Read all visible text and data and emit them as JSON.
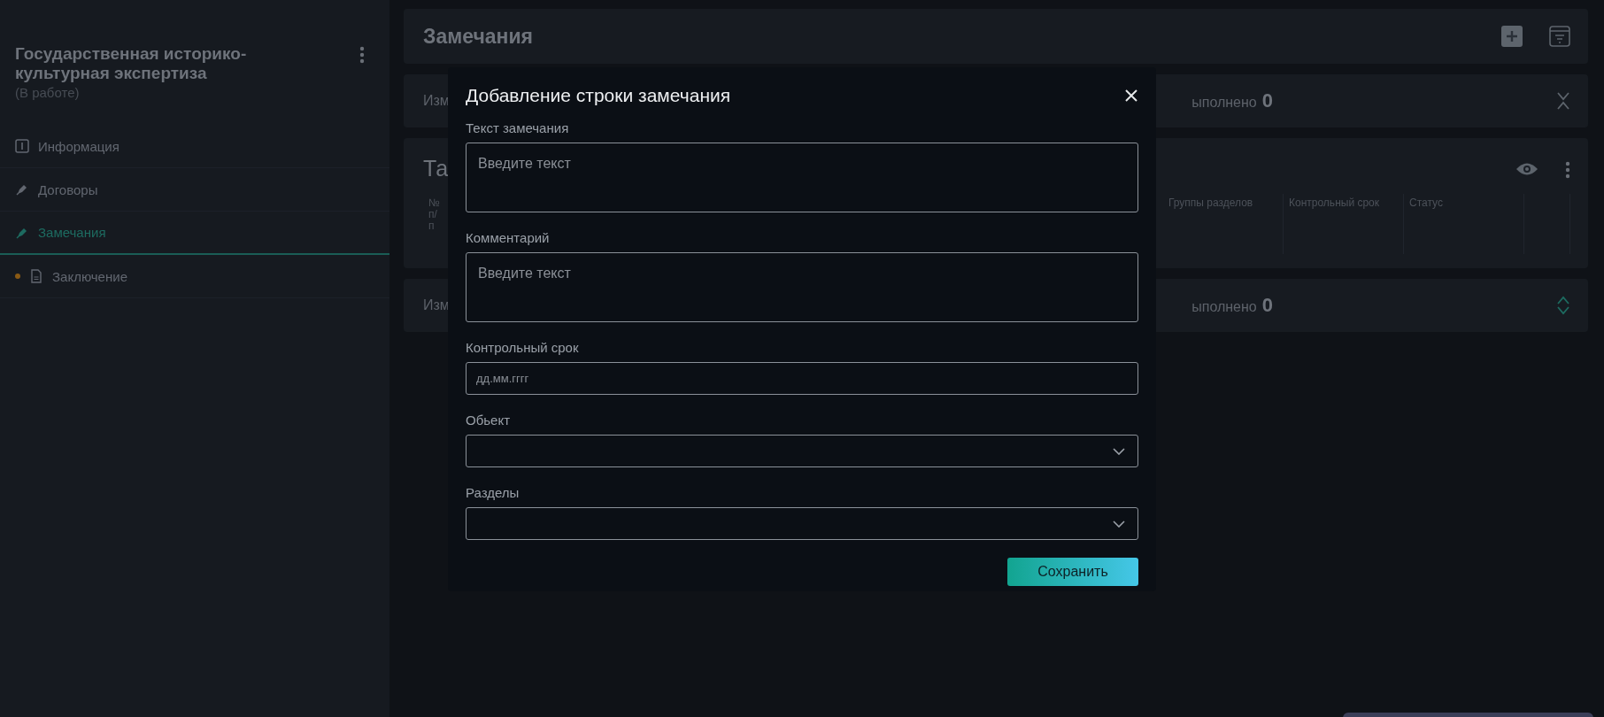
{
  "sidebar": {
    "title": "Государственная историко-культурная экспертиза",
    "status": "(В работе)",
    "items": [
      {
        "label": "Информация",
        "kind": "info",
        "selected": false,
        "dot": false
      },
      {
        "label": "Договоры",
        "kind": "pen",
        "selected": false,
        "dot": false
      },
      {
        "label": "Замечания",
        "kind": "pen",
        "selected": true,
        "dot": false
      },
      {
        "label": "Заключение",
        "kind": "doc",
        "selected": false,
        "dot": true
      }
    ]
  },
  "header": {
    "title": "Замечания"
  },
  "summaries": [
    {
      "label": "Изм",
      "done_label": "ыполнено",
      "done_count": "0",
      "expanded": true
    },
    {
      "label": "Изм",
      "done_label": "ыполнено",
      "done_count": "0",
      "expanded": false
    }
  ],
  "table_card": {
    "title": "Та",
    "first_column": "№ п/п",
    "columns": [
      "Группы разделов",
      "Контрольный срок",
      "Статус"
    ]
  },
  "modal": {
    "title": "Добавление строки замечания",
    "fields": [
      {
        "kind": "textarea",
        "label": "Текст замечания",
        "placeholder": "Введите текст"
      },
      {
        "kind": "textarea",
        "label": "Комментарий",
        "placeholder": "Введите текст"
      },
      {
        "kind": "date",
        "label": "Контрольный срок",
        "placeholder": "дд.мм.гггг"
      },
      {
        "kind": "select",
        "label": "Обьект"
      },
      {
        "kind": "select",
        "label": "Разделы"
      }
    ],
    "save_button": "Сохранить"
  }
}
